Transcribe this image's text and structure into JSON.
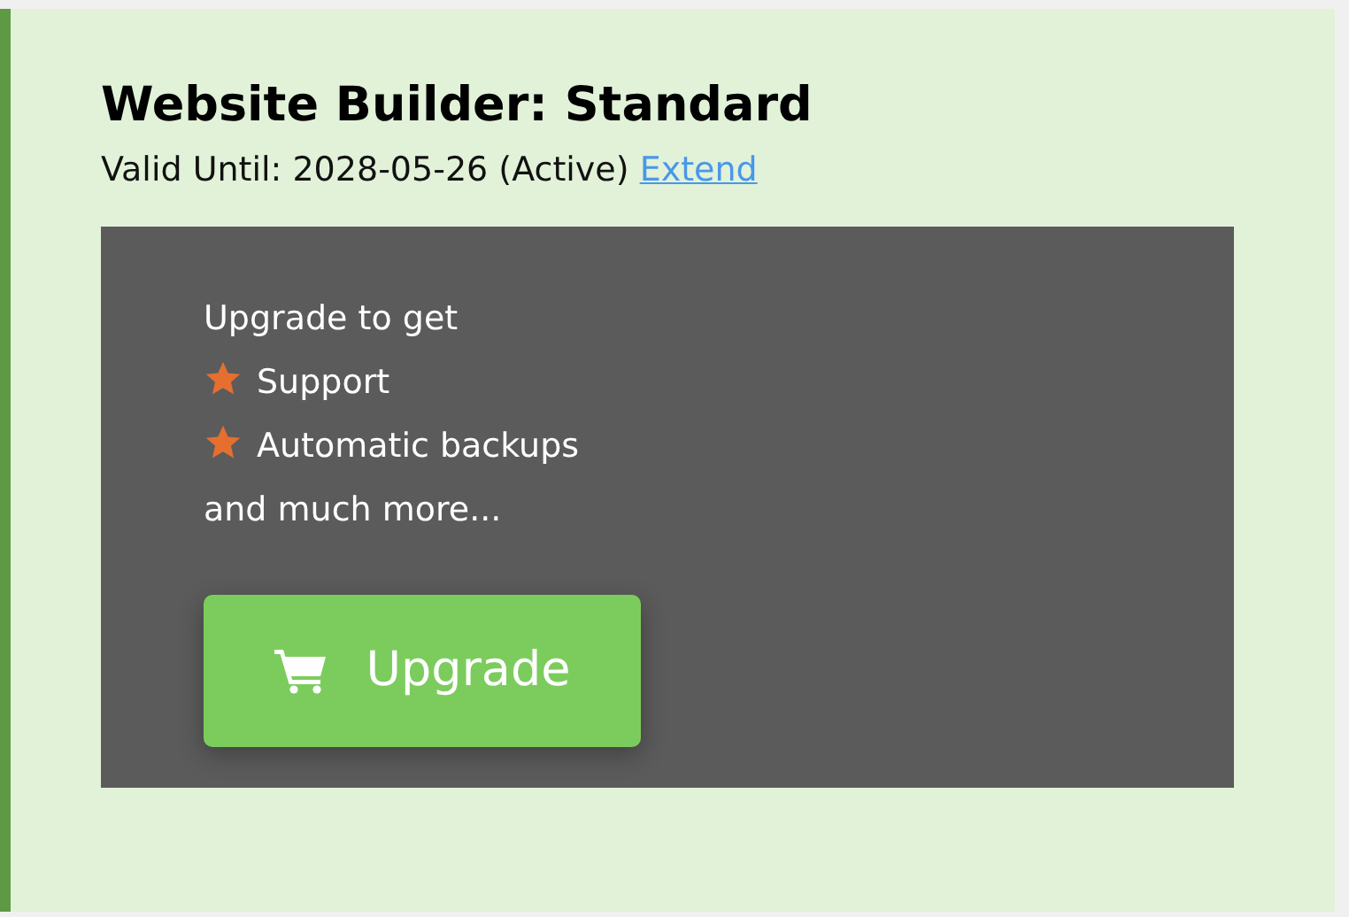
{
  "product": {
    "title": "Website Builder: Standard",
    "validity": "Valid Until: 2028-05-26 (Active)",
    "extend_link": "Extend"
  },
  "upgrade_panel": {
    "intro": "Upgrade to get",
    "features": [
      {
        "label": "Support"
      },
      {
        "label": "Automatic backups"
      }
    ],
    "outro": "and much more...",
    "button": "Upgrade"
  }
}
